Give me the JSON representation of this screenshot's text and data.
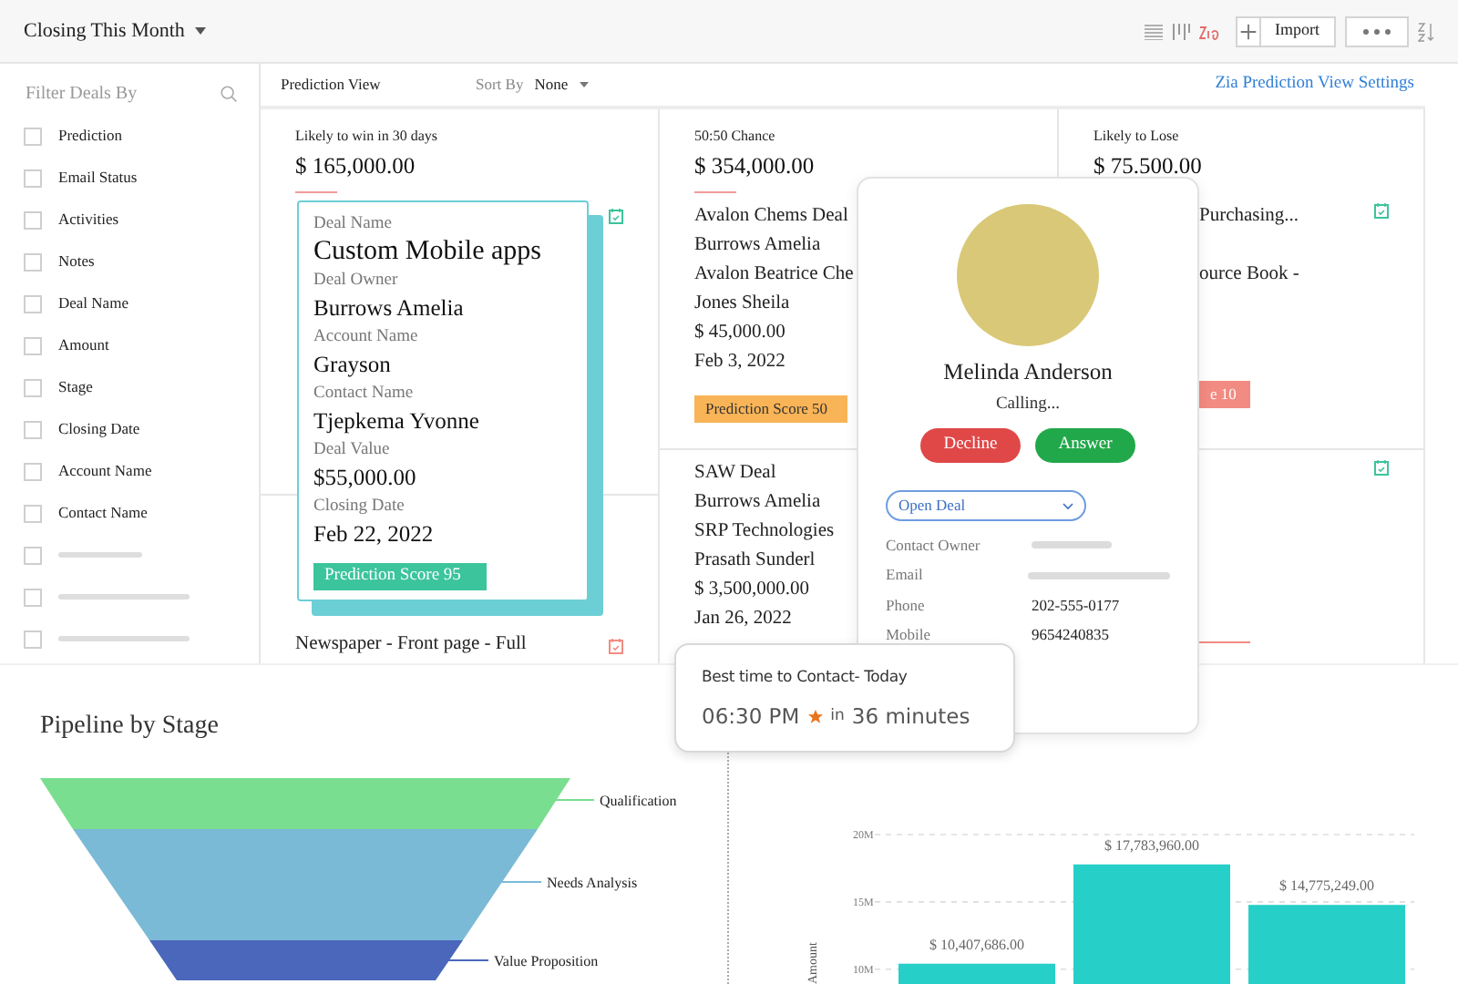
{
  "header": {
    "view_title": "Closing This Month",
    "import_button": "Import"
  },
  "sidebar": {
    "title": "Filter Deals By",
    "filters": [
      {
        "kind": "label",
        "label": "Prediction",
        "checked": false
      },
      {
        "kind": "label",
        "label": "Email Status",
        "checked": false
      },
      {
        "kind": "label",
        "label": "Activities",
        "checked": false
      },
      {
        "kind": "label",
        "label": "Notes",
        "checked": false
      },
      {
        "kind": "label",
        "label": "Deal Name",
        "checked": false
      },
      {
        "kind": "label",
        "label": "Amount",
        "checked": false
      },
      {
        "kind": "label",
        "label": "Stage",
        "checked": false
      },
      {
        "kind": "label",
        "label": "Closing Date",
        "checked": false
      },
      {
        "kind": "label",
        "label": "Account Name",
        "checked": false
      },
      {
        "kind": "label",
        "label": "Contact Name",
        "checked": false
      },
      {
        "kind": "skeleton",
        "checked": false
      },
      {
        "kind": "skeleton",
        "checked": false
      },
      {
        "kind": "skeleton",
        "checked": false
      }
    ]
  },
  "toolbar": {
    "view_name": "Prediction View",
    "sort_label": "Sort By",
    "sort_value": "None",
    "settings_link": "Zia Prediction View Settings"
  },
  "columns": [
    {
      "heading": "Likely to win in 30 days",
      "total": "$ 165,000.00",
      "deals": [
        {
          "kind": "card",
          "icon_alert": false,
          "fields": [
            {
              "label": "Deal Name",
              "value": "Custom Mobile apps"
            },
            {
              "label": "Deal Owner",
              "value": "Burrows Amelia"
            },
            {
              "label": "Account Name",
              "value": "Grayson"
            },
            {
              "label": "Contact Name",
              "value": "Tjepkema Yvonne"
            },
            {
              "label": "Deal Value",
              "value": "$55,000.00"
            },
            {
              "label": "Closing Date",
              "value": "Feb 22, 2022"
            }
          ],
          "score": "Prediction Score 95",
          "color": "#3cc49c"
        },
        {
          "kind": "list",
          "icon_alert": true,
          "lines": [
            "Newspaper - Front page - Full"
          ]
        }
      ]
    },
    {
      "heading": "50:50 Chance",
      "total": "$ 354,000.00",
      "deals": [
        {
          "kind": "list",
          "lines": [
            "Avalon Chems Deal",
            "Burrows Amelia",
            "Avalon Beatrice Che",
            "Jones Sheila",
            "$ 45,000.00",
            "Feb 3, 2022"
          ],
          "score": "Prediction Score 50",
          "color": "#f9b457"
        },
        {
          "kind": "list",
          "lines": [
            "SAW Deal",
            "Burrows Amelia",
            "SRP Technologies",
            "Prasath Sunderl",
            "$ 3,500,000.00",
            "Jan 26, 2022"
          ]
        }
      ]
    },
    {
      "heading": "Likely to Lose",
      "total": "$ 75.500.00",
      "deals": [
        {
          "kind": "list",
          "icon_alert": false,
          "lines": [
            "Purchasing...",
            "ource Book -"
          ],
          "score": "e 10",
          "color": "#f28b82"
        },
        {
          "kind": "list",
          "icon_alert": false,
          "color": "#f28b82"
        }
      ]
    }
  ],
  "call_popup": {
    "name": "Melinda Anderson",
    "status": "Calling...",
    "decline": "Decline",
    "answer": "Answer",
    "deal_select": "Open Deal",
    "fields": [
      {
        "label": "Contact Owner",
        "kind": "skeleton"
      },
      {
        "label": "Email",
        "kind": "skeleton"
      },
      {
        "label": "Phone",
        "kind": "text",
        "value": "202-555-0177"
      },
      {
        "label": "Mobile",
        "kind": "text",
        "value": "9654240835"
      }
    ]
  },
  "tooltip": {
    "title": "Best time to Contact- Today",
    "time": "06:30 PM",
    "connector": "in",
    "eta": "36 minutes"
  },
  "pipeline": {
    "title": "Pipeline by Stage",
    "stages": [
      {
        "name": "Qualification",
        "color": "#79de8f"
      },
      {
        "name": "Needs Analysis",
        "color": "#7abad6"
      },
      {
        "name": "Value Proposition",
        "color": "#4a67bb"
      }
    ]
  },
  "amount_chart": {
    "chart_data": {
      "type": "bar",
      "ylabel": "Amount",
      "values": [
        10407686,
        17783960,
        14775249
      ],
      "ylim": [
        8900000,
        20000000
      ],
      "yticks": [
        {
          "value": 10000000,
          "label": "10M"
        },
        {
          "value": 15000000,
          "label": "15M"
        },
        {
          "value": 20000000,
          "label": "20M"
        }
      ],
      "value_labels": [
        "$ 10,407,686.00",
        "$ 17,783,960.00",
        "$ 14,775,249.00"
      ]
    }
  }
}
